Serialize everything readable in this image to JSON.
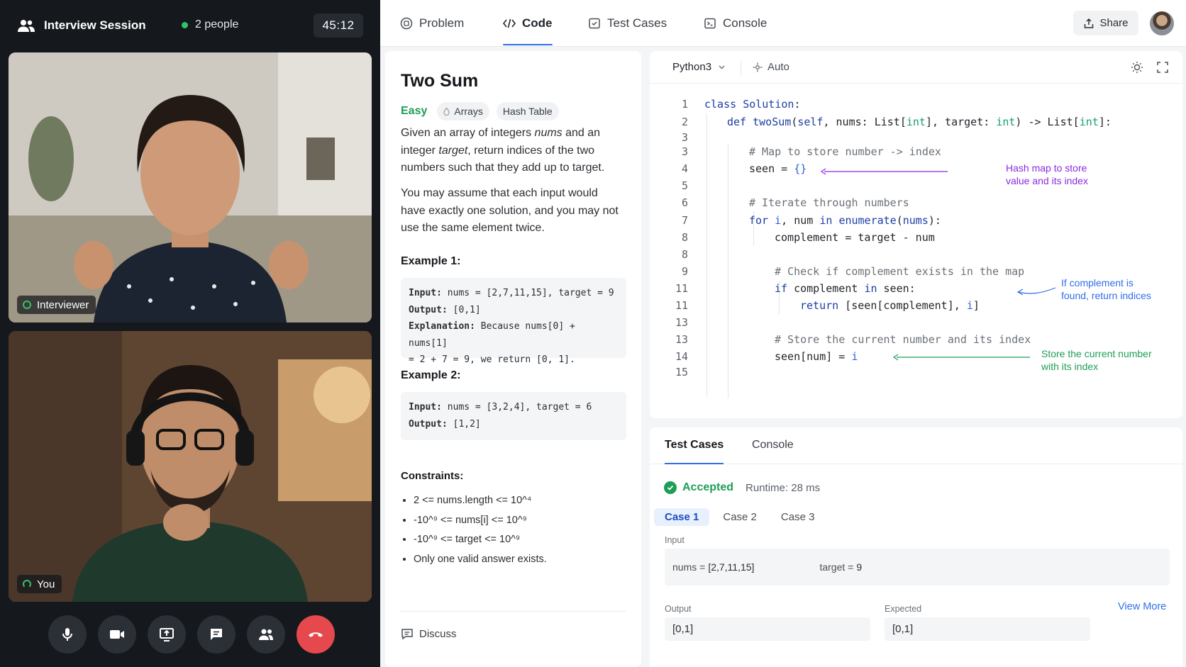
{
  "video": {
    "title": "Interview Session",
    "participants": "2 people",
    "timer": "45:12",
    "tiles": [
      {
        "label": "Interviewer"
      },
      {
        "label": "You"
      }
    ],
    "controls": [
      "mic-icon",
      "camera-icon",
      "screen-share-icon",
      "chat-icon",
      "participants-icon",
      "end-call-icon"
    ]
  },
  "topbar": {
    "tabs": [
      {
        "label": "Problem",
        "icon": "problem-icon"
      },
      {
        "label": "Code",
        "icon": "code-icon"
      },
      {
        "label": "Test Cases",
        "icon": "test-cases-icon"
      },
      {
        "label": "Console",
        "icon": "console-icon"
      }
    ],
    "active_tab": "Code",
    "share_label": "Share"
  },
  "problem": {
    "title": "Two Sum",
    "difficulty": "Easy",
    "tags": [
      "Arrays",
      "Hash Table"
    ],
    "para1": {
      "a": "Given an array of integers ",
      "b": "nums",
      "c": " and an integer ",
      "d": "target",
      "e": ", return indices of the two numbers such that they add up to target."
    },
    "para2": "You may assume that each input would have exactly one solution, and you may not use the same element twice.",
    "example1": {
      "heading": "Example 1:",
      "input_key": "Input:",
      "input_val": " nums = [2,7,11,15], target = 9",
      "output_key": "Output:",
      "output_val": " [0,1]",
      "expl_key": "Explanation:",
      "expl_val": " Because nums[0] + nums[1]",
      "expl_val2": "= 2 + 7 = 9, we return [0, 1]."
    },
    "example2": {
      "heading": "Example 2:",
      "input_key": "Input:",
      "input_val": " nums = [3,2,4], target = 6",
      "output_key": "Output:",
      "output_val": " [1,2]"
    },
    "constraints_heading": "Constraints:",
    "constraints": [
      "2 <= nums.length <= 10^⁴",
      "-10^⁹ <= nums[i] <= 10^⁹",
      "-10^⁹ <= target <= 10^⁹",
      "Only one valid answer exists."
    ],
    "discuss_label": "Discuss"
  },
  "editor": {
    "language": "Python3",
    "mode": "Auto",
    "line_numbers": [
      "1",
      "2",
      "3",
      "3",
      "4",
      "5",
      "6",
      "7",
      "8",
      "8",
      "9",
      "11",
      "11",
      "13",
      "13",
      "14",
      "15"
    ],
    "annotations": [
      {
        "text1": "Hash map to store",
        "text2": "value and its index",
        "color": "#8a2be2"
      },
      {
        "text1": "If complement is",
        "text2": "found, return indices",
        "color": "#2f6feb"
      },
      {
        "text1": "Store the current number",
        "text2": "with its index",
        "color": "#1d9e55"
      }
    ]
  },
  "results": {
    "tabs": [
      "Test Cases",
      "Console"
    ],
    "status": "Accepted",
    "runtime": "Runtime: 28 ms",
    "cases": [
      "Case 1",
      "Case 2",
      "Case 3"
    ],
    "input_label": "Input",
    "input_nums_key": "nums = ",
    "input_nums_val": "[2,7,11,15]",
    "input_target_key": "target = ",
    "input_target_val": "9",
    "output_label": "Output",
    "output_val": "[0,1]",
    "expected_label": "Expected",
    "expected_val": "[0,1]",
    "view_more": "View More"
  },
  "colors": {
    "accent": "#2f6feb",
    "success": "#1d9e55",
    "end_call": "#e5484d"
  }
}
